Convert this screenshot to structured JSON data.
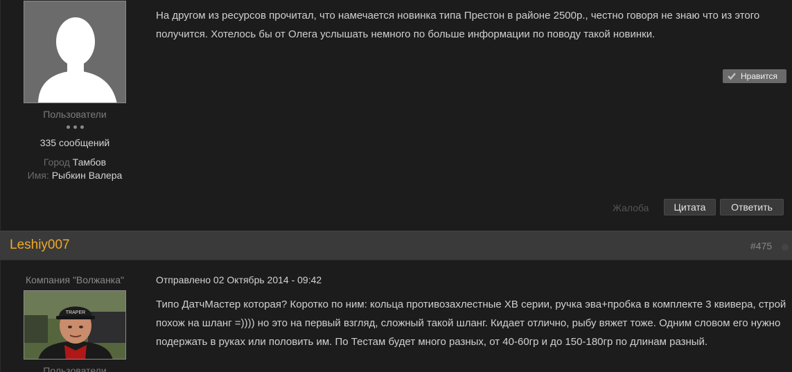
{
  "post_a": {
    "author_group": "Пользователи",
    "post_count": "335 сообщений",
    "city_label": "Город",
    "city_value": "Тамбов",
    "name_label": "Имя:",
    "name_value": "Рыбкин Валера",
    "text": "На другом из ресурсов прочитал, что намечается новинка типа Престон в районе 2500р., честно говоря не знаю что из этого получится. Хотелось бы от Олега услышать немного по больше информации по поводу такой новинки.",
    "like_label": "Нравится",
    "report_label": "Жалоба",
    "quote_label": "Цитата",
    "reply_label": "Ответить"
  },
  "post_b": {
    "username": "Leshiy007",
    "post_number": "#475",
    "company": "Компания \"Волжанка\"",
    "author_group": "Пользователи",
    "posted": "Отправлено 02 Октябрь 2014 - 09:42",
    "text": "Типо ДатчМастер которая? Коротко по ним: кольца противозахлестные ХВ серии, ручка эва+пробка в комплекте 3 квивера, строй похож на шланг =)))) но это на первый взгляд, сложный такой шланг. Кидает отлично, рыбу вяжет тоже. Одним словом его нужно подержать в руках или половить им. По Тестам будет много разных, от 40-60гр и до 150-180гр по длинам разный.",
    "avatar_cap_text": "TRAPER"
  },
  "colors": {
    "username": "#f0a928",
    "background": "#1c1c1c",
    "header_bar": "#3a3a3a"
  }
}
